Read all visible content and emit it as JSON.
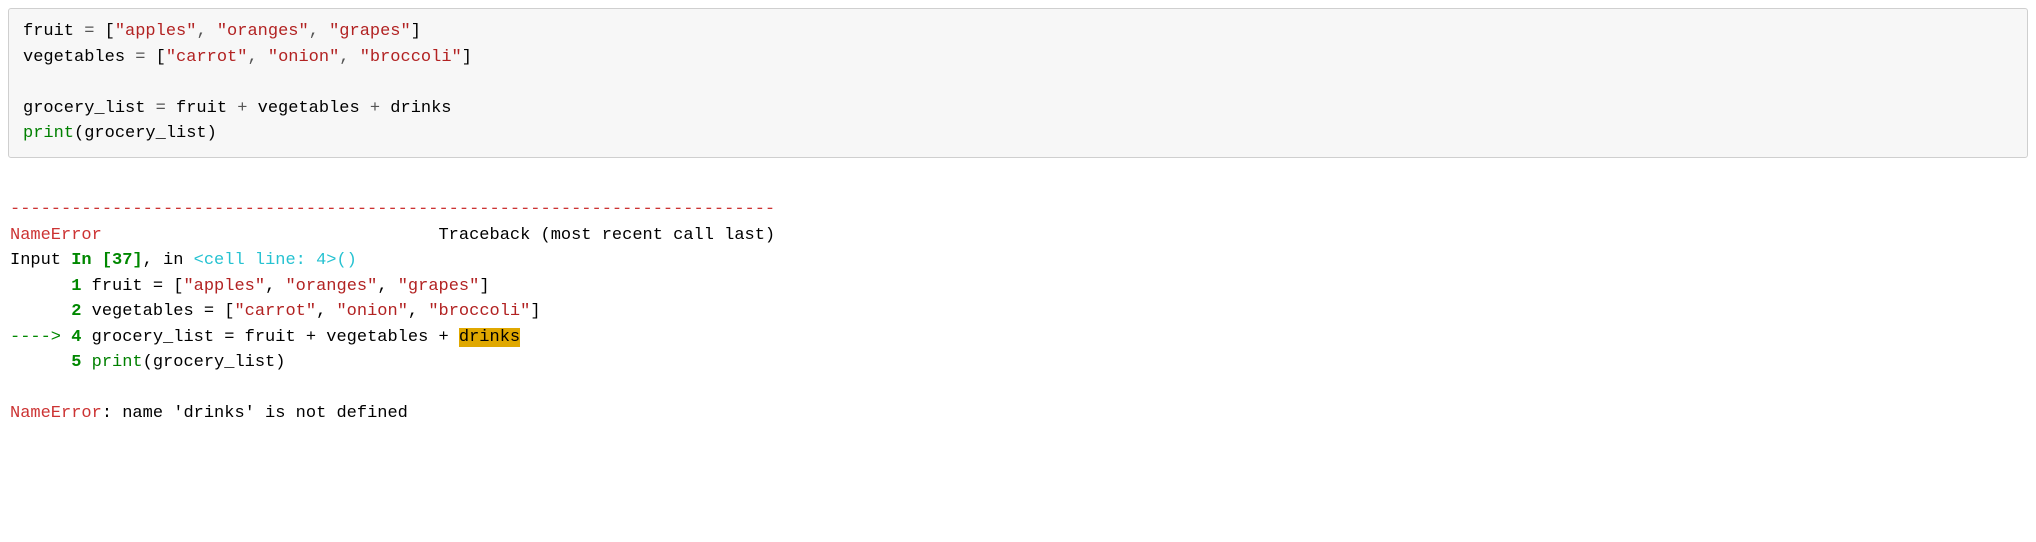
{
  "code": {
    "line1_var": "fruit",
    "line1_eq": " = ",
    "line1_b1": "[",
    "line1_s1": "\"apples\"",
    "line1_c1": ", ",
    "line1_s2": "\"oranges\"",
    "line1_c2": ", ",
    "line1_s3": "\"grapes\"",
    "line1_b2": "]",
    "line2_var": "vegetables",
    "line2_eq": " = ",
    "line2_b1": "[",
    "line2_s1": "\"carrot\"",
    "line2_c1": ", ",
    "line2_s2": "\"onion\"",
    "line2_c2": ", ",
    "line2_s3": "\"broccoli\"",
    "line2_b2": "]",
    "blank": "",
    "line4_var": "grocery_list",
    "line4_eq": " = ",
    "line4_a": "fruit",
    "line4_p1": " + ",
    "line4_b": "vegetables",
    "line4_p2": " + ",
    "line4_c": "drinks",
    "line5_fn": "print",
    "line5_p1": "(",
    "line5_arg": "grocery_list",
    "line5_p2": ")"
  },
  "output": {
    "dashes": "---------------------------------------------------------------------------",
    "err_type": "NameError",
    "traceback_label": "                                 Traceback (most recent call last)",
    "input_prefix": "Input ",
    "in_label": "In [37]",
    "in_comma": ", in ",
    "cell_line": "<cell line: 4>",
    "cell_parens": "()",
    "ctx1_num": "      1",
    "ctx1_text_a": " fruit = [",
    "ctx1_s1": "\"apples\"",
    "ctx1_c1": ", ",
    "ctx1_s2": "\"oranges\"",
    "ctx1_c2": ", ",
    "ctx1_s3": "\"grapes\"",
    "ctx1_text_b": "]",
    "ctx2_num": "      2",
    "ctx2_text_a": " vegetables = [",
    "ctx2_s1": "\"carrot\"",
    "ctx2_c1": ", ",
    "ctx2_s2": "\"onion\"",
    "ctx2_c2": ", ",
    "ctx2_s3": "\"broccoli\"",
    "ctx2_text_b": "]",
    "arrow": "----> ",
    "ctx4_num": "4",
    "ctx4_text_a": " grocery_list = fruit + vegetables + ",
    "ctx4_hl": "drinks",
    "ctx5_num": "      5",
    "ctx5_sp": " ",
    "ctx5_fn": "print",
    "ctx5_text": "(grocery_list)",
    "final_err": "NameError",
    "final_msg": ": name 'drinks' is not defined"
  }
}
